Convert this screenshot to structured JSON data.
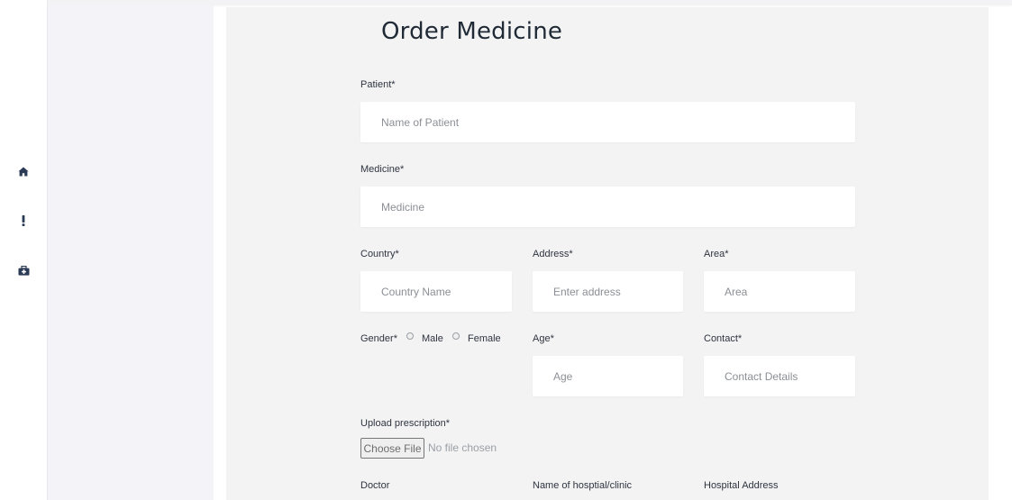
{
  "page": {
    "title": "Order Medicine"
  },
  "rail": {
    "icons": [
      "home-icon",
      "alert-icon",
      "medical-kit-icon"
    ],
    "icon_color": "#2b3a55"
  },
  "form": {
    "patient": {
      "label": "Patient*",
      "placeholder": "Name of Patient"
    },
    "medicine": {
      "label": "Medicine*",
      "placeholder": "Medicine"
    },
    "country": {
      "label": "Country*",
      "placeholder": "Country Name"
    },
    "address": {
      "label": "Address*",
      "placeholder": "Enter address"
    },
    "area": {
      "label": "Area*",
      "placeholder": "Area"
    },
    "gender": {
      "label": "Gender*",
      "options": [
        "Male",
        "Female"
      ]
    },
    "age": {
      "label": "Age*",
      "placeholder": "Age"
    },
    "contact": {
      "label": "Contact*",
      "placeholder": "Contact Details"
    },
    "prescription": {
      "label": "Upload prescription*",
      "button_label": "Choose File",
      "status": "No file chosen"
    },
    "doctor": {
      "label": "Doctor"
    },
    "hospital_name": {
      "label": "Name of hosptial/clinic"
    },
    "hospital_address": {
      "label": "Hospital Address"
    }
  },
  "colors": {
    "background": "#ffffff",
    "card": "#f3f3f3",
    "sidebar": "#f4f4f8",
    "input_bg": "#ffffff",
    "text": "#1f2a36",
    "placeholder": "#8b8f95"
  }
}
